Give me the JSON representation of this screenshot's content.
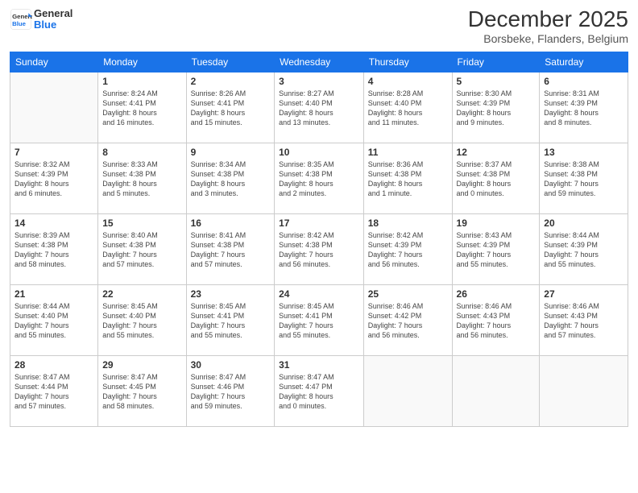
{
  "header": {
    "logo_general": "General",
    "logo_blue": "Blue",
    "month_title": "December 2025",
    "location": "Borsbeke, Flanders, Belgium"
  },
  "days_of_week": [
    "Sunday",
    "Monday",
    "Tuesday",
    "Wednesday",
    "Thursday",
    "Friday",
    "Saturday"
  ],
  "weeks": [
    [
      {
        "day": "",
        "info": ""
      },
      {
        "day": "1",
        "info": "Sunrise: 8:24 AM\nSunset: 4:41 PM\nDaylight: 8 hours\nand 16 minutes."
      },
      {
        "day": "2",
        "info": "Sunrise: 8:26 AM\nSunset: 4:41 PM\nDaylight: 8 hours\nand 15 minutes."
      },
      {
        "day": "3",
        "info": "Sunrise: 8:27 AM\nSunset: 4:40 PM\nDaylight: 8 hours\nand 13 minutes."
      },
      {
        "day": "4",
        "info": "Sunrise: 8:28 AM\nSunset: 4:40 PM\nDaylight: 8 hours\nand 11 minutes."
      },
      {
        "day": "5",
        "info": "Sunrise: 8:30 AM\nSunset: 4:39 PM\nDaylight: 8 hours\nand 9 minutes."
      },
      {
        "day": "6",
        "info": "Sunrise: 8:31 AM\nSunset: 4:39 PM\nDaylight: 8 hours\nand 8 minutes."
      }
    ],
    [
      {
        "day": "7",
        "info": "Sunrise: 8:32 AM\nSunset: 4:39 PM\nDaylight: 8 hours\nand 6 minutes."
      },
      {
        "day": "8",
        "info": "Sunrise: 8:33 AM\nSunset: 4:38 PM\nDaylight: 8 hours\nand 5 minutes."
      },
      {
        "day": "9",
        "info": "Sunrise: 8:34 AM\nSunset: 4:38 PM\nDaylight: 8 hours\nand 3 minutes."
      },
      {
        "day": "10",
        "info": "Sunrise: 8:35 AM\nSunset: 4:38 PM\nDaylight: 8 hours\nand 2 minutes."
      },
      {
        "day": "11",
        "info": "Sunrise: 8:36 AM\nSunset: 4:38 PM\nDaylight: 8 hours\nand 1 minute."
      },
      {
        "day": "12",
        "info": "Sunrise: 8:37 AM\nSunset: 4:38 PM\nDaylight: 8 hours\nand 0 minutes."
      },
      {
        "day": "13",
        "info": "Sunrise: 8:38 AM\nSunset: 4:38 PM\nDaylight: 7 hours\nand 59 minutes."
      }
    ],
    [
      {
        "day": "14",
        "info": "Sunrise: 8:39 AM\nSunset: 4:38 PM\nDaylight: 7 hours\nand 58 minutes."
      },
      {
        "day": "15",
        "info": "Sunrise: 8:40 AM\nSunset: 4:38 PM\nDaylight: 7 hours\nand 57 minutes."
      },
      {
        "day": "16",
        "info": "Sunrise: 8:41 AM\nSunset: 4:38 PM\nDaylight: 7 hours\nand 57 minutes."
      },
      {
        "day": "17",
        "info": "Sunrise: 8:42 AM\nSunset: 4:38 PM\nDaylight: 7 hours\nand 56 minutes."
      },
      {
        "day": "18",
        "info": "Sunrise: 8:42 AM\nSunset: 4:39 PM\nDaylight: 7 hours\nand 56 minutes."
      },
      {
        "day": "19",
        "info": "Sunrise: 8:43 AM\nSunset: 4:39 PM\nDaylight: 7 hours\nand 55 minutes."
      },
      {
        "day": "20",
        "info": "Sunrise: 8:44 AM\nSunset: 4:39 PM\nDaylight: 7 hours\nand 55 minutes."
      }
    ],
    [
      {
        "day": "21",
        "info": "Sunrise: 8:44 AM\nSunset: 4:40 PM\nDaylight: 7 hours\nand 55 minutes."
      },
      {
        "day": "22",
        "info": "Sunrise: 8:45 AM\nSunset: 4:40 PM\nDaylight: 7 hours\nand 55 minutes."
      },
      {
        "day": "23",
        "info": "Sunrise: 8:45 AM\nSunset: 4:41 PM\nDaylight: 7 hours\nand 55 minutes."
      },
      {
        "day": "24",
        "info": "Sunrise: 8:45 AM\nSunset: 4:41 PM\nDaylight: 7 hours\nand 55 minutes."
      },
      {
        "day": "25",
        "info": "Sunrise: 8:46 AM\nSunset: 4:42 PM\nDaylight: 7 hours\nand 56 minutes."
      },
      {
        "day": "26",
        "info": "Sunrise: 8:46 AM\nSunset: 4:43 PM\nDaylight: 7 hours\nand 56 minutes."
      },
      {
        "day": "27",
        "info": "Sunrise: 8:46 AM\nSunset: 4:43 PM\nDaylight: 7 hours\nand 57 minutes."
      }
    ],
    [
      {
        "day": "28",
        "info": "Sunrise: 8:47 AM\nSunset: 4:44 PM\nDaylight: 7 hours\nand 57 minutes."
      },
      {
        "day": "29",
        "info": "Sunrise: 8:47 AM\nSunset: 4:45 PM\nDaylight: 7 hours\nand 58 minutes."
      },
      {
        "day": "30",
        "info": "Sunrise: 8:47 AM\nSunset: 4:46 PM\nDaylight: 7 hours\nand 59 minutes."
      },
      {
        "day": "31",
        "info": "Sunrise: 8:47 AM\nSunset: 4:47 PM\nDaylight: 8 hours\nand 0 minutes."
      },
      {
        "day": "",
        "info": ""
      },
      {
        "day": "",
        "info": ""
      },
      {
        "day": "",
        "info": ""
      }
    ]
  ]
}
